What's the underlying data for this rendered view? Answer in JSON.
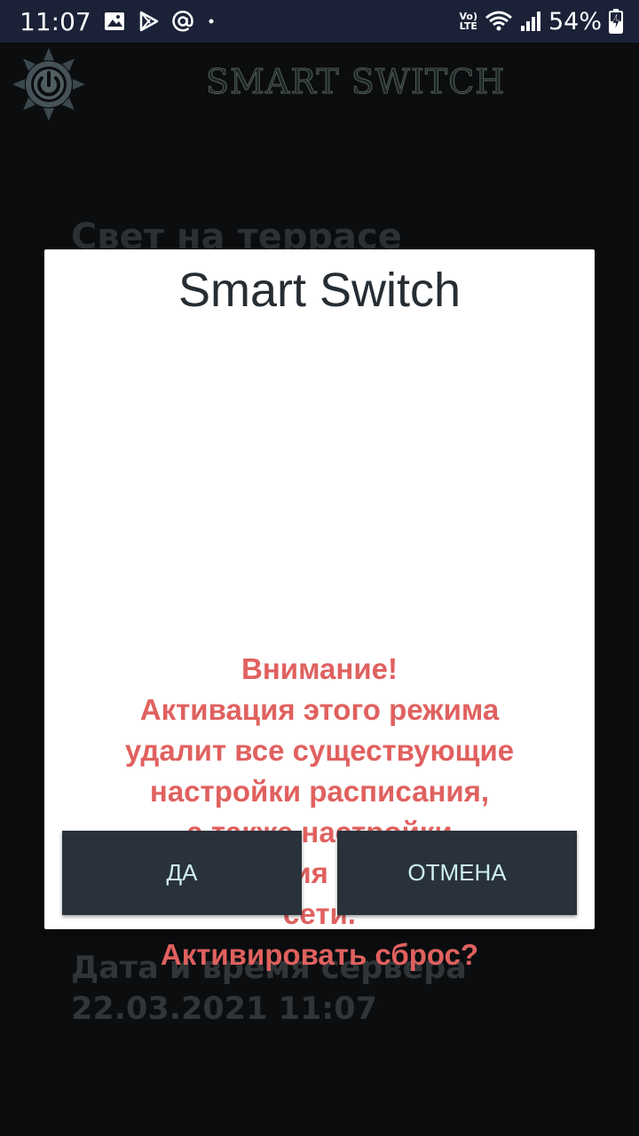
{
  "status_bar": {
    "time": "11:07",
    "battery_percent": "54%",
    "volte_top": "Vo)",
    "volte_bottom": "LTE",
    "icons": [
      "image-icon",
      "play-store-icon",
      "at-sign-icon",
      "dot-icon",
      "wifi-icon",
      "signal-icon",
      "battery-charging-icon"
    ]
  },
  "app_bar": {
    "title": "SMART SWITCH",
    "logo_icon": "power-sun-icon"
  },
  "background": {
    "heading": "Свет на террасе",
    "server_label": "Дата и время сервера",
    "server_datetime": "22.03.2021 11:07"
  },
  "dialog": {
    "title": "Smart Switch",
    "message_lines": [
      "Внимание!",
      "Активация этого режима",
      "удалит все существующие",
      "настройки расписания,",
      "а также настройки",
      "подключения к дамашней",
      "сети.",
      "Активировать сброс?"
    ],
    "confirm_label": "ДА",
    "cancel_label": "ОТМЕНА"
  },
  "colors": {
    "status_bar_bg": "#1b2238",
    "app_bg": "#111417",
    "dialog_bg": "#ffffff",
    "message_color": "#e0615f",
    "button_bg": "#29323b",
    "button_text": "#cfeef5"
  }
}
